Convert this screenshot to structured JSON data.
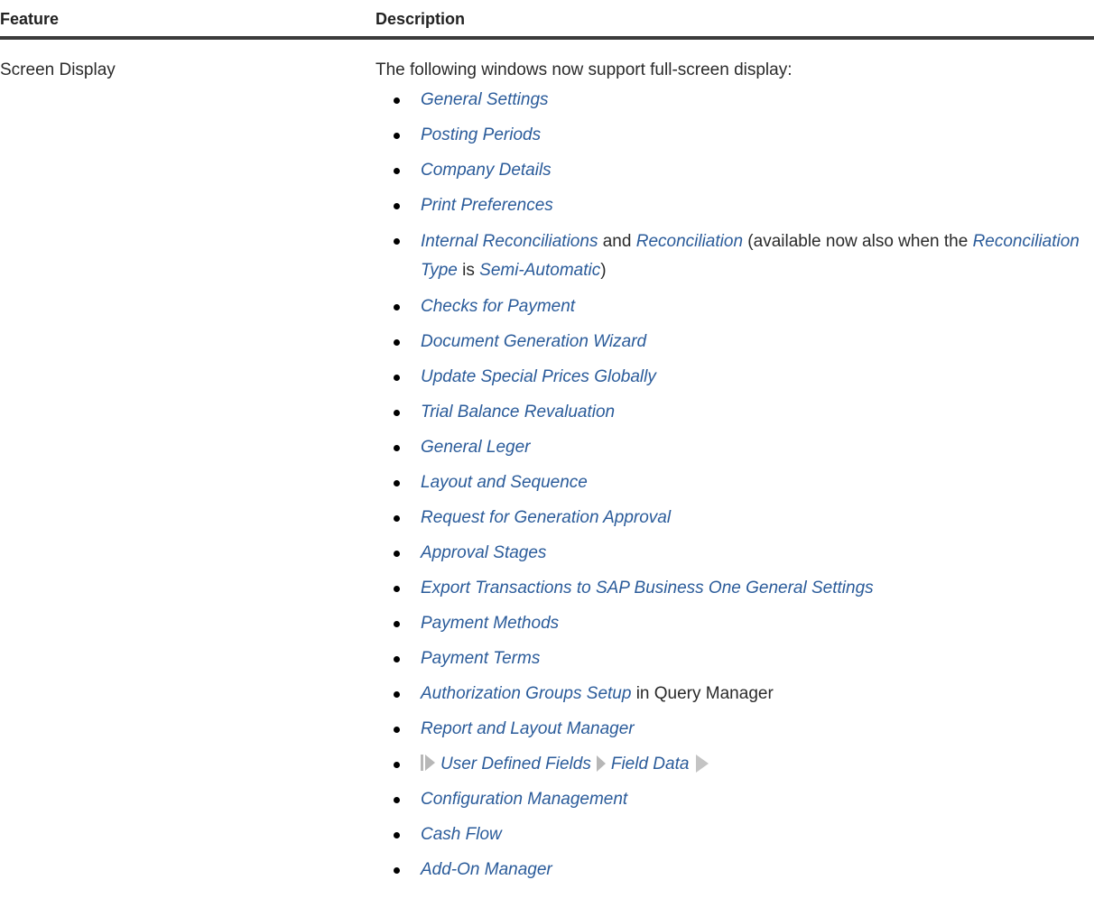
{
  "header": {
    "feature_label": "Feature",
    "description_label": "Description"
  },
  "row": {
    "feature": "Screen Display",
    "intro": "The following windows now support full-screen display:",
    "items": {
      "general_settings": "General Settings",
      "posting_periods": "Posting Periods",
      "company_details": "Company Details",
      "print_preferences": "Print Preferences",
      "internal_reconciliations": {
        "link1": "Internal Reconciliations",
        "and": "and",
        "link2": "Reconciliation",
        "text1": "(available now also when the",
        "link3": "Reconciliation Type",
        "is": "is",
        "link4": "Semi-Automatic",
        "close": ")"
      },
      "checks_for_payment": "Checks for Payment",
      "document_generation_wizard": "Document Generation Wizard",
      "update_special_prices": "Update Special Prices Globally",
      "trial_balance_revaluation": "Trial Balance Revaluation",
      "general_leger": "General Leger",
      "layout_and_sequence": "Layout and Sequence",
      "request_for_generation_approval": "Request for Generation Approval",
      "approval_stages": "Approval Stages",
      "export_transactions": "Export Transactions to SAP Business One General Settings",
      "payment_methods": "Payment Methods",
      "payment_terms": "Payment Terms",
      "authorization_groups": {
        "link": "Authorization Groups Setup",
        "text": "in Query Manager"
      },
      "report_layout_manager": "Report and Layout Manager",
      "udf_path": {
        "step1": "User Defined Fields",
        "step2": "Field Data"
      },
      "configuration_management": "Configuration Management",
      "cash_flow": "Cash Flow",
      "add_on_manager": "Add-On Manager"
    }
  },
  "colors": {
    "link": "#2a5b9a",
    "text": "#2a2a2a",
    "header_rule": "#3c3c3c",
    "nav_arrow": "#b7b7b7"
  }
}
